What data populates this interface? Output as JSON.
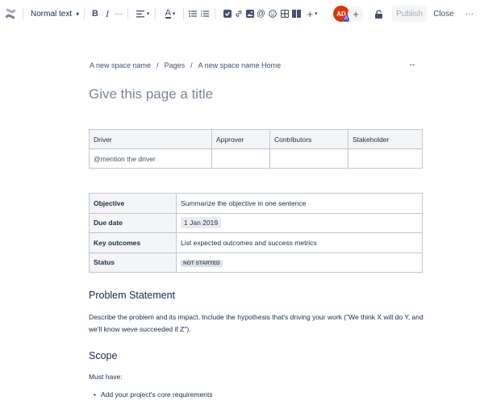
{
  "toolbar": {
    "text_style": "Normal text",
    "bold": "B",
    "italic": "I",
    "more_formatting": "···",
    "avatar_initials": "AD",
    "avatar_badge": "A",
    "invite": "+",
    "publish_label": "Publish",
    "close_label": "Close",
    "more_menu": "···"
  },
  "breadcrumb": {
    "space": "A new space name",
    "sep1": "/",
    "pages": "Pages",
    "sep2": "/",
    "home": "A new space name Home"
  },
  "width_toggle": "↔",
  "title_placeholder": "Give this page a title",
  "daci_table": {
    "headers": [
      "Driver",
      "Approver",
      "Contributors",
      "Stakeholder"
    ],
    "row": [
      "@mention the driver",
      "",
      "",
      ""
    ]
  },
  "summary_table": {
    "rows": [
      {
        "label": "Objective",
        "value": "Summarize the objective in one sentence"
      },
      {
        "label": "Due date",
        "value": "1 Jan 2019"
      },
      {
        "label": "Key outcomes",
        "value": "List expected outcomes and success metrics"
      },
      {
        "label": "Status",
        "value": "NOT STARTED"
      }
    ]
  },
  "problem": {
    "heading": "Problem Statement",
    "text": "Describe the problem and its impact. Include the hypothesis that's driving your work (\"We think X will do Y, and we'll know weve succeeded if Z\")."
  },
  "scope": {
    "heading": "Scope",
    "must_have": "Must have:",
    "items": [
      "Add your project's core requirements"
    ]
  },
  "colors": {
    "accent": "#0052cc",
    "avatar": "#de350b",
    "badge": "#6554c0",
    "text": "#172b4d"
  },
  "icons": [
    "confluence-logo-icon",
    "align-icon",
    "text-color-icon",
    "bullet-list-icon",
    "numbered-list-icon",
    "action-item-icon",
    "link-icon",
    "image-icon",
    "mention-icon",
    "emoji-icon",
    "table-icon",
    "layout-icon",
    "insert-icon",
    "restriction-icon",
    "width-toggle-icon"
  ]
}
